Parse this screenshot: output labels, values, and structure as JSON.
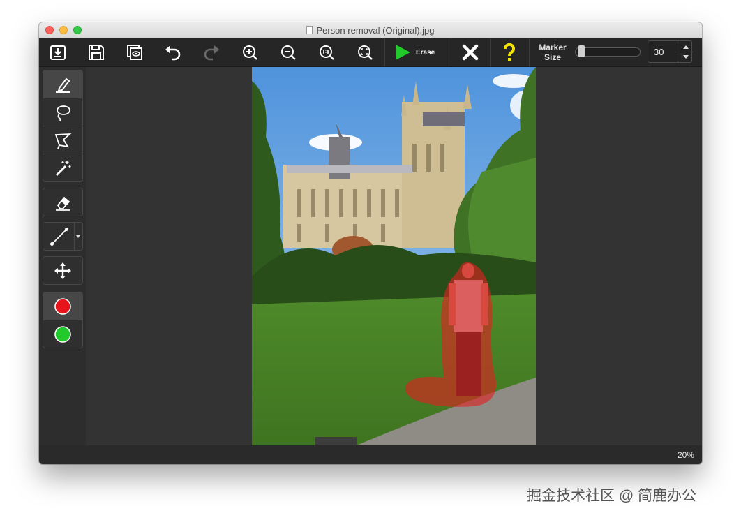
{
  "window": {
    "title": "Person removal (Original).jpg"
  },
  "toolbar": {
    "buttons": [
      {
        "name": "open",
        "icon": "import-icon"
      },
      {
        "name": "save",
        "icon": "save-icon"
      },
      {
        "name": "compare",
        "icon": "preview-icon"
      },
      {
        "name": "undo",
        "icon": "undo-icon"
      },
      {
        "name": "redo",
        "icon": "redo-icon"
      },
      {
        "name": "zoom-in",
        "icon": "zoom-in-icon"
      },
      {
        "name": "zoom-out",
        "icon": "zoom-out-icon"
      },
      {
        "name": "actual-size",
        "icon": "zoom-actual-size-icon"
      },
      {
        "name": "fit",
        "icon": "zoom-fit-icon"
      }
    ],
    "erase_label": "Erase",
    "clear_icon": "close-x-icon",
    "help_icon": "question-icon",
    "marker_size_label_1": "Marker",
    "marker_size_label_2": "Size",
    "marker_size_value": "30",
    "marker_slider_level": 0.05
  },
  "sidebar": {
    "tools": [
      {
        "name": "marker",
        "icon": "marker-pen-icon",
        "active": true
      },
      {
        "name": "lasso",
        "icon": "lasso-icon"
      },
      {
        "name": "polygon-lasso",
        "icon": "polygon-lasso-icon"
      },
      {
        "name": "magic-wand",
        "icon": "magic-wand-icon"
      },
      {
        "name": "eraser",
        "icon": "eraser-icon"
      },
      {
        "name": "line",
        "icon": "line-icon"
      },
      {
        "name": "move",
        "icon": "move-arrows-icon"
      }
    ],
    "colors": [
      {
        "name": "red-marker",
        "color": "#e8141b",
        "active": true
      },
      {
        "name": "green-marker",
        "color": "#22c92a"
      }
    ]
  },
  "status": {
    "zoom": "20%"
  },
  "colors": {
    "accent_green": "#22c92a",
    "help_yellow": "#f5e400",
    "mask_red": "#e02020"
  },
  "watermark": "掘金技术社区 @ 简鹿办公"
}
